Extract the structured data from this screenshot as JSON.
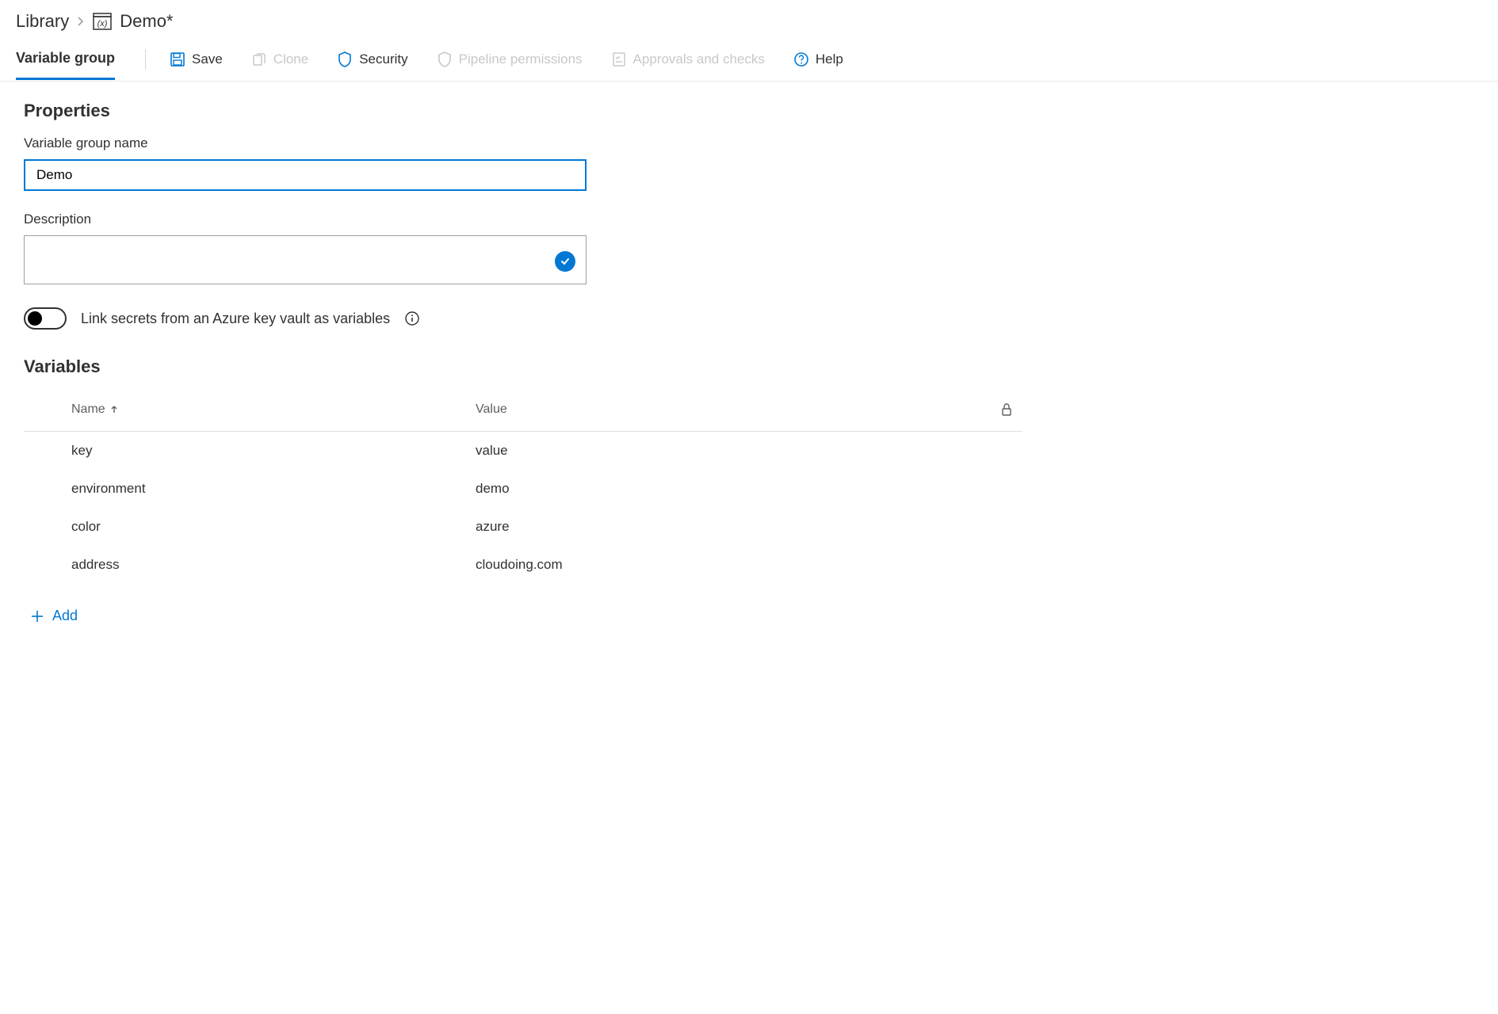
{
  "breadcrumb": {
    "library": "Library",
    "current": "Demo*"
  },
  "tab": {
    "label": "Variable group"
  },
  "toolbar": {
    "save": "Save",
    "clone": "Clone",
    "security": "Security",
    "pipeline_permissions": "Pipeline permissions",
    "approvals_checks": "Approvals and checks",
    "help": "Help"
  },
  "properties": {
    "heading": "Properties",
    "name_label": "Variable group name",
    "name_value": "Demo",
    "description_label": "Description",
    "description_value": "",
    "toggle_label": "Link secrets from an Azure key vault as variables",
    "toggle_on": false
  },
  "variables": {
    "heading": "Variables",
    "columns": {
      "name": "Name",
      "value": "Value"
    },
    "rows": [
      {
        "name": "key",
        "value": "value"
      },
      {
        "name": "environment",
        "value": "demo"
      },
      {
        "name": "color",
        "value": "azure"
      },
      {
        "name": "address",
        "value": "cloudoing.com"
      }
    ],
    "add_label": "Add"
  }
}
